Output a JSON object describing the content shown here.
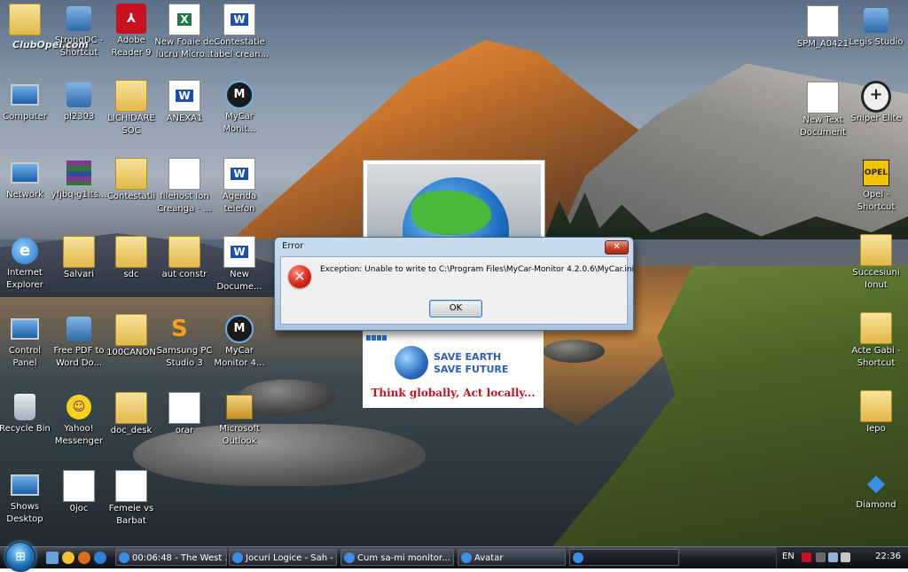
{
  "desktop": {
    "watermark": "ClubOpel.com",
    "icons_left": [
      {
        "label1": "",
        "label2": "",
        "name": "top-left-folder",
        "kind": "folder"
      },
      {
        "label1": "StrongDC -",
        "label2": "Shortcut",
        "name": "strongdc-shortcut",
        "kind": "app"
      },
      {
        "label1": "Adobe",
        "label2": "Reader 9",
        "name": "adobe-reader",
        "kind": "pdf"
      },
      {
        "label1": "New Foaie de",
        "label2": "lucru Micro...",
        "name": "new-foaie-de-lucru",
        "kind": "excel"
      },
      {
        "label1": "Contestatie",
        "label2": "tabel crean...",
        "name": "contestatie-tabel",
        "kind": "word"
      },
      {
        "label1": "Computer",
        "label2": "",
        "name": "computer",
        "kind": "computer"
      },
      {
        "label1": "pl2303",
        "label2": "",
        "name": "pl2303",
        "kind": "app"
      },
      {
        "label1": "LICHIDARE",
        "label2": "SOC",
        "name": "lichidare-soc",
        "kind": "folder"
      },
      {
        "label1": "ANEXA1",
        "label2": "",
        "name": "anexa1",
        "kind": "word"
      },
      {
        "label1": "MyCar",
        "label2": "Monit...",
        "name": "mycar-monitor-1",
        "kind": "mycar"
      },
      {
        "label1": "Network",
        "label2": "",
        "name": "network",
        "kind": "computer"
      },
      {
        "label1": "yfjbq-g1lts...",
        "label2": "",
        "name": "yfjbq-archive",
        "kind": "rar"
      },
      {
        "label1": "Contestatii",
        "label2": "",
        "name": "contestatii",
        "kind": "folder"
      },
      {
        "label1": "filehost Ion",
        "label2": "Creanga - ...",
        "name": "filehost-ion-creanga",
        "kind": "mp3"
      },
      {
        "label1": "Agenda",
        "label2": "telefon",
        "name": "agenda-telefon",
        "kind": "word"
      },
      {
        "label1": "Internet",
        "label2": "Explorer",
        "name": "internet-explorer",
        "kind": "ie"
      },
      {
        "label1": "Salvari",
        "label2": "",
        "name": "salvari",
        "kind": "folder"
      },
      {
        "label1": "sdc",
        "label2": "",
        "name": "sdc",
        "kind": "folder"
      },
      {
        "label1": "aut constr",
        "label2": "",
        "name": "aut-constr",
        "kind": "folder"
      },
      {
        "label1": "New",
        "label2": "Docume...",
        "name": "new-document",
        "kind": "word"
      },
      {
        "label1": "Control",
        "label2": "Panel",
        "name": "control-panel",
        "kind": "computer"
      },
      {
        "label1": "Free PDF to",
        "label2": "Word Do...",
        "name": "free-pdf-to-word",
        "kind": "app"
      },
      {
        "label1": "100CANON",
        "label2": "",
        "name": "100canon",
        "kind": "folder"
      },
      {
        "label1": "Samsung PC",
        "label2": "Studio 3",
        "name": "samsung-pc-studio",
        "kind": "samsung"
      },
      {
        "label1": "MyCar",
        "label2": "Monitor 4...",
        "name": "mycar-monitor-2",
        "kind": "mycar"
      },
      {
        "label1": "Recycle Bin",
        "label2": "",
        "name": "recycle-bin",
        "kind": "bin"
      },
      {
        "label1": "Yahoo!",
        "label2": "Messenger",
        "name": "yahoo-messenger",
        "kind": "yahoo"
      },
      {
        "label1": "doc_desk",
        "label2": "",
        "name": "doc-desk",
        "kind": "folder"
      },
      {
        "label1": "orar",
        "label2": "",
        "name": "orar",
        "kind": "doc"
      },
      {
        "label1": "Microsoft",
        "label2": "Outlook",
        "name": "microsoft-outlook",
        "kind": "outlook"
      },
      {
        "label1": "Shows",
        "label2": "Desktop",
        "name": "shows-desktop",
        "kind": "computer"
      },
      {
        "label1": "0joc",
        "label2": "",
        "name": "0joc",
        "kind": "doc"
      },
      {
        "label1": "Femeie vs",
        "label2": "Barbat",
        "name": "femeie-vs-barbat",
        "kind": "doc"
      }
    ],
    "icons_right": [
      {
        "label1": "SPM_A0421",
        "label2": "",
        "name": "spm-a0421",
        "kind": "doc"
      },
      {
        "label1": "Legis Studio",
        "label2": "",
        "name": "legis-studio",
        "kind": "app"
      },
      {
        "label1": "New Text",
        "label2": "Document",
        "name": "new-text-document",
        "kind": "doc"
      },
      {
        "label1": "Sniper Elite",
        "label2": "",
        "name": "sniper-elite",
        "kind": "sniper"
      },
      {
        "label1": "Opel -",
        "label2": "Shortcut",
        "name": "opel-shortcut",
        "kind": "opel"
      },
      {
        "label1": "Succesiuni",
        "label2": "Ionut",
        "name": "succesiuni-ionut",
        "kind": "folder"
      },
      {
        "label1": "Acte Gabi -",
        "label2": "Shortcut",
        "name": "acte-gabi-shortcut",
        "kind": "folder"
      },
      {
        "label1": "Iepo",
        "label2": "",
        "name": "iepo",
        "kind": "folder"
      },
      {
        "label1": "Diamond",
        "label2": "",
        "name": "diamond",
        "kind": "diamond"
      }
    ]
  },
  "splash": {
    "save_line1": "SAVE EARTH",
    "save_line2": "SAVE FUTURE",
    "slogan": "Think globally, Act locally..."
  },
  "dialog": {
    "title": "Error",
    "close_glyph": "✕",
    "icon_glyph": "✕",
    "message": "Exception: Unable to write to C:\\Program Files\\MyCar-Monitor 4.2.0.6\\MyCar.ini",
    "ok_label": "OK"
  },
  "taskbar": {
    "start_glyph": "⊞",
    "tasks": [
      {
        "label": "00:06:48 - The West ...",
        "name": "task-the-west"
      },
      {
        "label": "Jocuri Logice - Sah - ...",
        "name": "task-jocuri-logice"
      },
      {
        "label": "Cum sa-mi monitor...",
        "name": "task-cum-sa-mi-monitor"
      },
      {
        "label": "Avatar",
        "name": "task-avatar"
      },
      {
        "label": "",
        "name": "task-mycar-active"
      }
    ],
    "lang": "EN",
    "clock": "22:36"
  },
  "colors": {
    "dialog_title_bg": "#c9dcef",
    "close_red": "#c2402a",
    "error_red": "#d8261a",
    "taskbar_bg": "#1d2127"
  }
}
